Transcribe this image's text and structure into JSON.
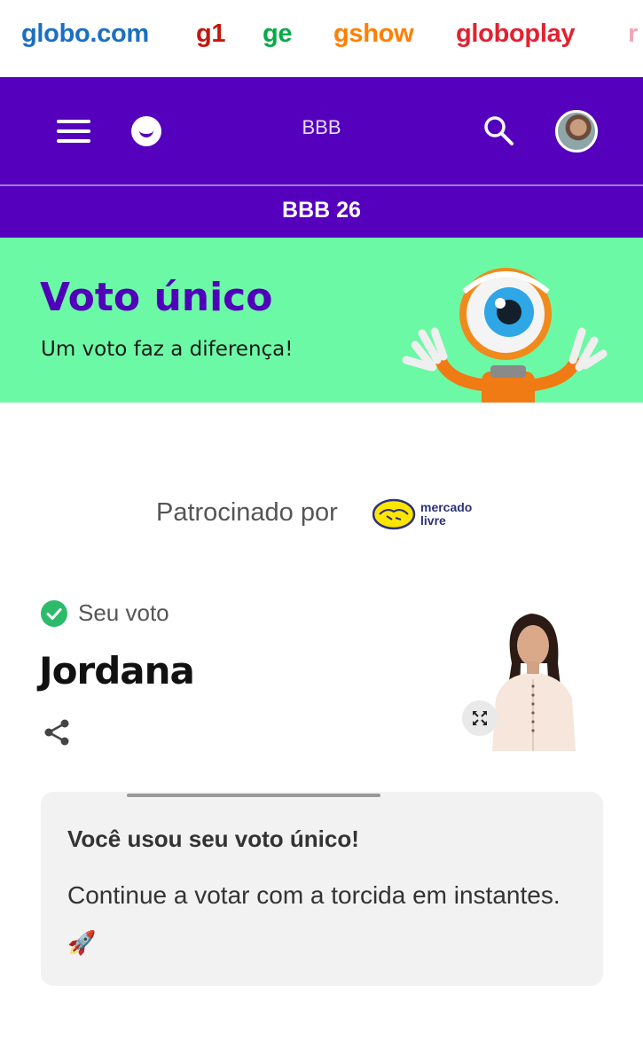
{
  "portal_links": [
    {
      "label": "globo.com",
      "color": "#1a6fc4"
    },
    {
      "label": "g1",
      "color": "#c4170c"
    },
    {
      "label": "ge",
      "color": "#06aa48"
    },
    {
      "label": "gshow",
      "color": "#ff7f00"
    },
    {
      "label": "globoplay",
      "color": "#e4202f"
    },
    {
      "label": "r",
      "color": "#f2a6b6"
    }
  ],
  "header": {
    "menu_icon": "hamburger-menu-icon",
    "logo_icon": "gshow-smile-logo-icon",
    "title": "BBB",
    "search_icon": "search-icon",
    "avatar_icon": "user-avatar"
  },
  "subnav": {
    "title": "BBB 26"
  },
  "banner": {
    "title": "Voto único",
    "subtitle": "Um voto faz a diferença!",
    "mascot_icon": "big-brother-eye-mascot"
  },
  "sponsor": {
    "label": "Patrocinado por",
    "logo_line1": "mercado",
    "logo_line2": "livre"
  },
  "vote": {
    "status_icon": "check-circle-icon",
    "status_label": "Seu voto",
    "candidate_name": "Jordana",
    "share_icon": "share-icon",
    "expand_icon": "expand-icon"
  },
  "info_card": {
    "title": "Você usou seu voto único!",
    "body": "Continue a votar com a torcida em instantes.",
    "emoji": "🚀"
  },
  "colors": {
    "header_purple": "#5500bd",
    "banner_green": "#6cf9a5",
    "title_purple": "#5000b9",
    "check_green": "#2bbb6b",
    "card_bg": "#f2f2f2"
  }
}
